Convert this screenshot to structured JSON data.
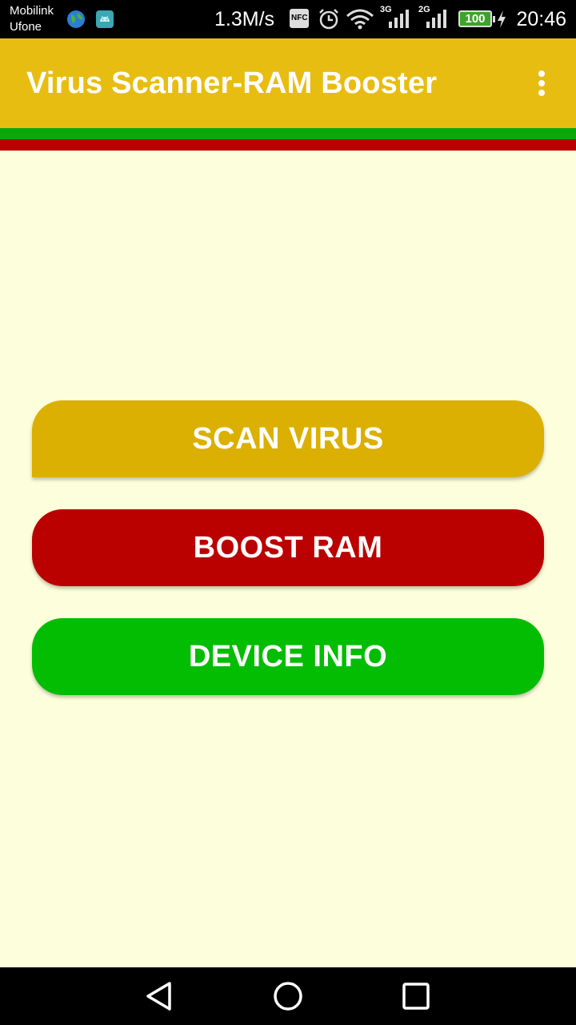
{
  "status_bar": {
    "carrier_1": "Mobilink",
    "carrier_2": "Ufone",
    "speed": "1.3M/s",
    "nfc": "NFC",
    "net_1": "3G",
    "net_2": "2G",
    "battery": "100",
    "time": "20:46",
    "icons": [
      "globe-icon",
      "android-icon",
      "nfc-icon",
      "alarm-icon",
      "wifi-icon",
      "signal-icon",
      "battery-icon",
      "charging-icon"
    ]
  },
  "toolbar": {
    "title": "Virus Scanner-RAM Booster",
    "color": "#e8bd12",
    "overflow_icon": "more-vert-icon"
  },
  "stripes": {
    "green": "#0aa60a",
    "red": "#b80000"
  },
  "buttons": {
    "scan": {
      "label": "SCAN VIRUS",
      "color": "#dbb002"
    },
    "boost": {
      "label": "BOOST RAM",
      "color": "#bb0000"
    },
    "device": {
      "label": "DEVICE INFO",
      "color": "#03bd03"
    }
  },
  "nav_bar": {
    "icons": [
      "back-icon",
      "home-icon",
      "recents-icon"
    ]
  }
}
